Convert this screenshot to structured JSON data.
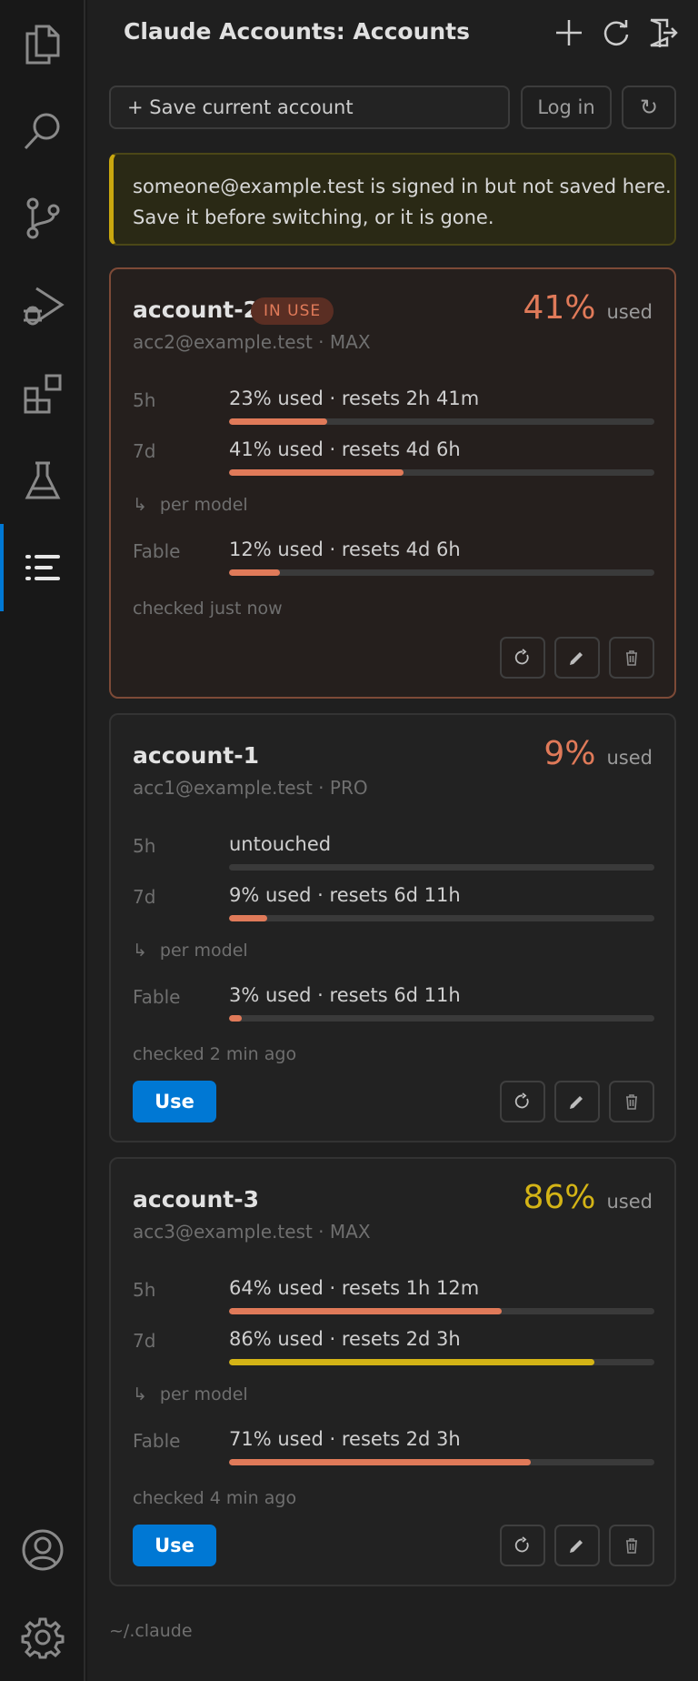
{
  "colors": {
    "accent_blue": "#0078d4",
    "usage_orange": "#e07a59",
    "usage_yellow": "#d4b416",
    "warning_border": "#c9a70f"
  },
  "activity_bar": {
    "items": [
      "explorer-icon",
      "search-icon",
      "source-control-icon",
      "run-debug-icon",
      "extensions-icon",
      "testing-icon",
      "accounts-list-icon"
    ],
    "bottom": [
      "account-icon",
      "settings-gear-icon"
    ]
  },
  "header": {
    "title": "Claude Accounts: Accounts",
    "actions": [
      "add-icon",
      "refresh-icon",
      "logout-icon"
    ]
  },
  "toolbar": {
    "save_label": "+ Save current account",
    "login_label": "Log in",
    "reload_label": "↻"
  },
  "warning": {
    "line1": "someone@example.test is signed in but not saved here.",
    "line2": "Save it before switching, or it is gone."
  },
  "accounts": [
    {
      "name": "account-2",
      "badge": "IN USE",
      "subtitle": "acc2@example.test · MAX",
      "percent": "41%",
      "percent_label": "used",
      "percent_color": "#e07a59",
      "rows": [
        {
          "label": "5h",
          "text": "23% used · resets 2h 41m",
          "fill": 0.23,
          "color": "#e07a59"
        },
        {
          "label": "7d",
          "text": "41% used · resets 4d 6h",
          "fill": 0.41,
          "color": "#e07a59"
        }
      ],
      "per_model_label": "per model",
      "per_model_arrow": "↳",
      "model_rows": [
        {
          "label": "Fable",
          "text": "12% used · resets 4d 6h",
          "fill": 0.12,
          "color": "#e07a59"
        }
      ],
      "checked": "checked just now",
      "use_label": ""
    },
    {
      "name": "account-1",
      "badge": "",
      "subtitle": "acc1@example.test · PRO",
      "percent": "9%",
      "percent_label": "used",
      "percent_color": "#e07a59",
      "rows": [
        {
          "label": "5h",
          "text": "untouched",
          "fill": 0,
          "color": "#e07a59"
        },
        {
          "label": "7d",
          "text": "9% used · resets 6d 11h",
          "fill": 0.09,
          "color": "#e07a59"
        }
      ],
      "per_model_label": "per model",
      "per_model_arrow": "↳",
      "model_rows": [
        {
          "label": "Fable",
          "text": "3% used · resets 6d 11h",
          "fill": 0.03,
          "color": "#e07a59"
        }
      ],
      "checked": "checked 2 min ago",
      "use_label": "Use"
    },
    {
      "name": "account-3",
      "badge": "",
      "subtitle": "acc3@example.test · MAX",
      "percent": "86%",
      "percent_label": "used",
      "percent_color": "#d4b416",
      "rows": [
        {
          "label": "5h",
          "text": "64% used · resets 1h 12m",
          "fill": 0.64,
          "color": "#e07a59"
        },
        {
          "label": "7d",
          "text": "86% used · resets 2d 3h",
          "fill": 0.86,
          "color": "#d4b416"
        }
      ],
      "per_model_label": "per model",
      "per_model_arrow": "↳",
      "model_rows": [
        {
          "label": "Fable",
          "text": "71% used · resets 2d 3h",
          "fill": 0.71,
          "color": "#e07a59"
        }
      ],
      "checked": "checked 4 min ago",
      "use_label": "Use"
    }
  ],
  "footer": {
    "path": "~/.claude"
  }
}
